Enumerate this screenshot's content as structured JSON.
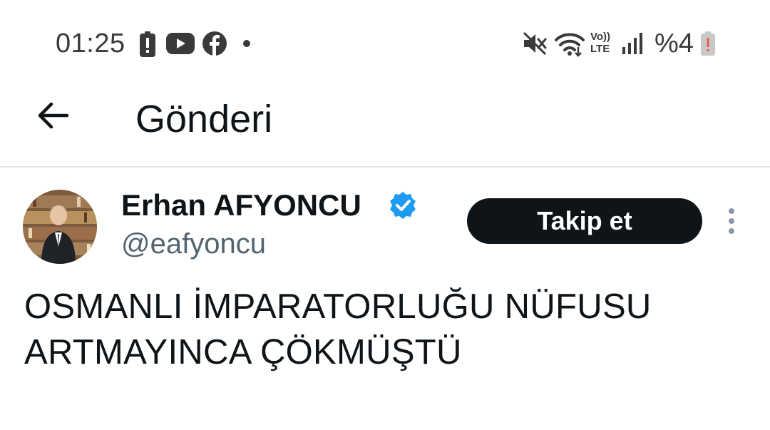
{
  "status_bar": {
    "time": "01:25",
    "battery_percent": "%4",
    "icons": [
      "battery-alert-icon",
      "youtube-icon",
      "facebook-icon",
      "notification-dot-icon",
      "mute-icon",
      "wifi-icon",
      "volte-icon",
      "signal-icon",
      "battery-low-icon"
    ],
    "volte_top": "Vo))",
    "volte_bottom": "LTE"
  },
  "header": {
    "title": "Gönderi",
    "back_icon": "arrow-left-icon"
  },
  "tweet": {
    "display_name": "Erhan AFYONCU",
    "handle": "@eafyoncu",
    "verified": true,
    "verified_color": "#1d9bf0",
    "follow_label": "Takip et",
    "more_icon": "more-vertical-icon",
    "text": "OSMANLI İMPARATORLUĞU NÜFUSU ARTMAYINCA ÇÖKMÜŞTÜ"
  },
  "colors": {
    "text_primary": "#0f1419",
    "text_secondary": "#536471",
    "follow_bg": "#0f1419",
    "divider": "#e1e6ea"
  }
}
